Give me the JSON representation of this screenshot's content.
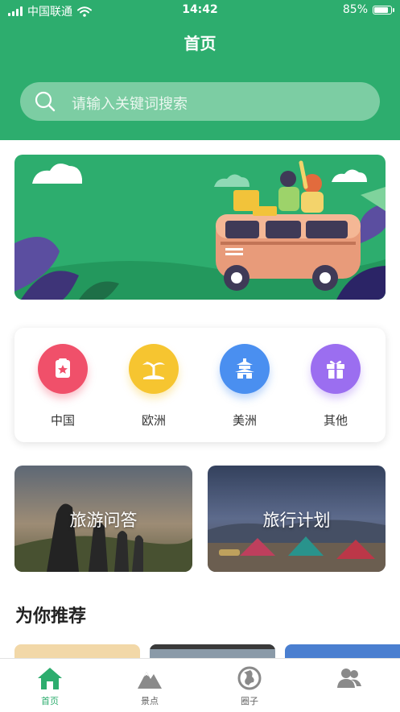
{
  "status_bar": {
    "carrier": "中国联通",
    "time": "14:42",
    "battery": "85%",
    "battery_level": 0.85
  },
  "header": {
    "title": "首页",
    "search_placeholder": "请输入关键词搜索"
  },
  "colors": {
    "primary": "#2dad6e",
    "china": "#f0506a",
    "europe": "#f6c530",
    "america": "#4a8ff0",
    "other": "#9b6ef0"
  },
  "categories": [
    {
      "label": "中国",
      "icon": "ticket-star-icon"
    },
    {
      "label": "欧洲",
      "icon": "palm-tree-icon"
    },
    {
      "label": "美洲",
      "icon": "temple-icon"
    },
    {
      "label": "其他",
      "icon": "gift-icon"
    }
  ],
  "tiles": [
    {
      "label": "旅游问答"
    },
    {
      "label": "旅行计划"
    }
  ],
  "section": {
    "title": "为你推荐"
  },
  "tabs": [
    {
      "label": "首页",
      "icon": "home-icon",
      "active": true
    },
    {
      "label": "景点",
      "icon": "mountain-icon",
      "active": false
    },
    {
      "label": "圈子",
      "icon": "globe-icon",
      "active": false
    },
    {
      "label": "",
      "icon": "users-icon",
      "active": false
    }
  ]
}
